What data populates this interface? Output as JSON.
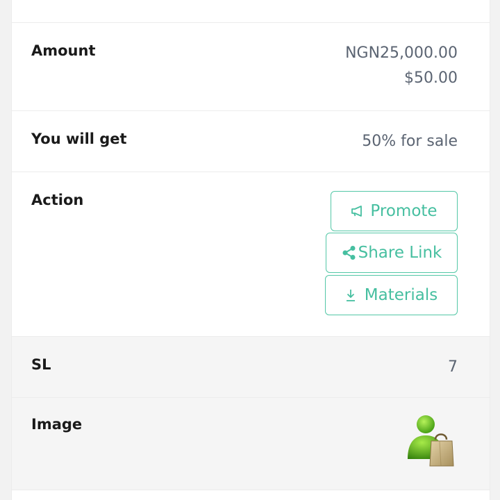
{
  "rows": {
    "amount": {
      "label": "Amount",
      "value_primary": "NGN25,000.00",
      "value_secondary": "$50.00"
    },
    "you_will_get": {
      "label": "You will get",
      "value": "50% for sale"
    },
    "action": {
      "label": "Action",
      "buttons": {
        "promote": {
          "label": "Promote",
          "icon": "megaphone-icon"
        },
        "share": {
          "label": "Share Link",
          "icon": "share-icon"
        },
        "materials": {
          "label": "Materials",
          "icon": "download-icon"
        }
      }
    },
    "sl": {
      "label": "SL",
      "value": "7"
    },
    "image": {
      "label": "Image",
      "icon": "user-shopping-bag-icon"
    }
  },
  "colors": {
    "accent": "#46bfa0",
    "value_text": "#5b6472",
    "label_text": "#1a1a1a"
  }
}
